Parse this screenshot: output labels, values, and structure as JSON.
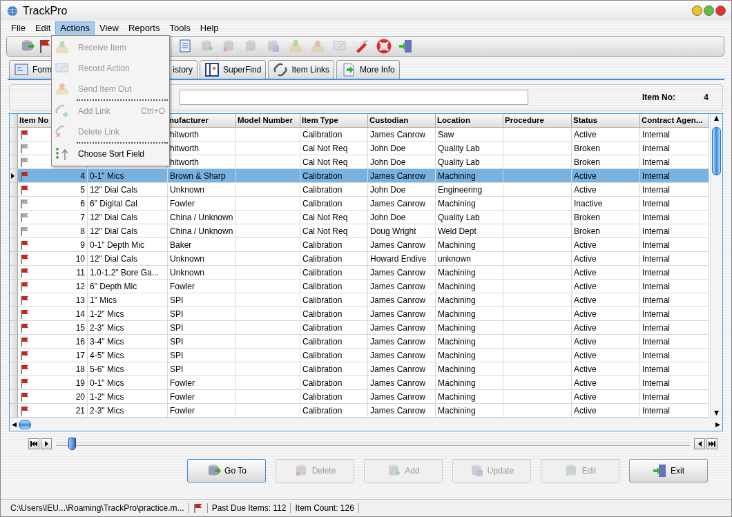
{
  "window": {
    "title": "TrackPro"
  },
  "menu_bar": [
    {
      "label": "File",
      "selected": false
    },
    {
      "label": "Edit",
      "selected": false
    },
    {
      "label": "Actions",
      "selected": true
    },
    {
      "label": "View",
      "selected": false
    },
    {
      "label": "Reports",
      "selected": false
    },
    {
      "label": "Tools",
      "selected": false
    },
    {
      "label": "Help",
      "selected": false
    }
  ],
  "actions_menu": [
    {
      "kind": "item",
      "label": "Receive Item",
      "disabled": true
    },
    {
      "kind": "item",
      "label": "Record Action",
      "disabled": true
    },
    {
      "kind": "item",
      "label": "Send Item Out",
      "disabled": true
    },
    {
      "kind": "separator"
    },
    {
      "kind": "item",
      "label": "Add Link",
      "shortcut": "Ctrl+O",
      "disabled": true
    },
    {
      "kind": "item",
      "label": "Delete Link",
      "disabled": true
    },
    {
      "kind": "separator"
    },
    {
      "kind": "item",
      "label": "Choose Sort Field",
      "disabled": false
    }
  ],
  "tabs": [
    {
      "label": "Form",
      "selected": false
    },
    {
      "label": "istory",
      "selected": false
    },
    {
      "label": "SuperFind",
      "selected": false
    },
    {
      "label": "Item Links",
      "selected": false
    },
    {
      "label": "More Info",
      "selected": false
    }
  ],
  "item_no": {
    "label": "Item No:",
    "value": "4"
  },
  "table": {
    "columns": [
      "Item No",
      "",
      "nufacturer",
      "Model Number",
      "Item Type",
      "Custodian",
      "Location",
      "Procedure",
      "Status",
      "Contract Agen..."
    ],
    "rows": [
      {
        "selected": false,
        "flagged": true,
        "cells": [
          "",
          "",
          "hitworth",
          "",
          "Calibration",
          "James Canrow",
          "Saw",
          "",
          "Active",
          "Internal"
        ]
      },
      {
        "selected": false,
        "flagged": false,
        "cells": [
          "",
          "",
          "hitworth",
          "",
          "Cal Not Req",
          "John Doe",
          "Quality Lab",
          "",
          "Broken",
          "Internal"
        ]
      },
      {
        "selected": false,
        "flagged": false,
        "cells": [
          "",
          "",
          "hitworth",
          "",
          "Cal Not Req",
          "John Doe",
          "Quality Lab",
          "",
          "Broken",
          "Internal"
        ]
      },
      {
        "selected": true,
        "flagged": true,
        "cells": [
          "4",
          "0-1\" Mics",
          "Brown & Sharp",
          "",
          "Calibration",
          "James Canrow",
          "Machining",
          "",
          "Active",
          "Internal"
        ]
      },
      {
        "selected": false,
        "flagged": true,
        "cells": [
          "5",
          "12\" Dial Cals",
          "Unknown",
          "",
          "Calibration",
          "John Doe",
          "Engineering",
          "",
          "Active",
          "Internal"
        ]
      },
      {
        "selected": false,
        "flagged": false,
        "cells": [
          "6",
          "6\" Digital Cal",
          "Fowler",
          "",
          "Calibration",
          "James Canrow",
          "Machining",
          "",
          "Inactive",
          "Internal"
        ]
      },
      {
        "selected": false,
        "flagged": false,
        "cells": [
          "7",
          "12\" Dial Cals",
          "China / Unknown",
          "",
          "Cal Not Req",
          "John Doe",
          "Quality Lab",
          "",
          "Broken",
          "Internal"
        ]
      },
      {
        "selected": false,
        "flagged": false,
        "cells": [
          "8",
          "12\" Dial Cals",
          "China / Unknown",
          "",
          "Cal Not Req",
          "Doug Wright",
          "Weld Dept",
          "",
          "Broken",
          "Internal"
        ]
      },
      {
        "selected": false,
        "flagged": true,
        "cells": [
          "9",
          "0-1\" Depth Mic",
          "Baker",
          "",
          "Calibration",
          "James Canrow",
          "Machining",
          "",
          "Active",
          "Internal"
        ]
      },
      {
        "selected": false,
        "flagged": true,
        "cells": [
          "10",
          "12\" Dial Cals",
          "Unknown",
          "",
          "Calibration",
          "Howard Endive",
          "unknown",
          "",
          "Active",
          "Internal"
        ]
      },
      {
        "selected": false,
        "flagged": true,
        "cells": [
          "11",
          "1.0-1.2\" Bore Ga...",
          "Unknown",
          "",
          "Calibration",
          "James Canrow",
          "Machining",
          "",
          "Active",
          "Internal"
        ]
      },
      {
        "selected": false,
        "flagged": true,
        "cells": [
          "12",
          "6\" Depth Mic",
          "Fowler",
          "",
          "Calibration",
          "James Canrow",
          "Machining",
          "",
          "Active",
          "Internal"
        ]
      },
      {
        "selected": false,
        "flagged": true,
        "cells": [
          "13",
          "1\" Mics",
          "SPI",
          "",
          "Calibration",
          "James Canrow",
          "Machining",
          "",
          "Active",
          "Internal"
        ]
      },
      {
        "selected": false,
        "flagged": true,
        "cells": [
          "14",
          "1-2\" Mics",
          "SPI",
          "",
          "Calibration",
          "James Canrow",
          "Machining",
          "",
          "Active",
          "Internal"
        ]
      },
      {
        "selected": false,
        "flagged": true,
        "cells": [
          "15",
          "2-3\" Mics",
          "SPI",
          "",
          "Calibration",
          "James Canrow",
          "Machining",
          "",
          "Active",
          "Internal"
        ]
      },
      {
        "selected": false,
        "flagged": true,
        "cells": [
          "16",
          "3-4\" Mics",
          "SPI",
          "",
          "Calibration",
          "James Canrow",
          "Machining",
          "",
          "Active",
          "Internal"
        ]
      },
      {
        "selected": false,
        "flagged": true,
        "cells": [
          "17",
          "4-5\" Mics",
          "SPI",
          "",
          "Calibration",
          "James Canrow",
          "Machining",
          "",
          "Active",
          "Internal"
        ]
      },
      {
        "selected": false,
        "flagged": true,
        "cells": [
          "18",
          "5-6\" Mics",
          "SPI",
          "",
          "Calibration",
          "James Canrow",
          "Machining",
          "",
          "Active",
          "Internal"
        ]
      },
      {
        "selected": false,
        "flagged": true,
        "cells": [
          "19",
          "0-1\" Mics",
          "Fowler",
          "",
          "Calibration",
          "James Canrow",
          "Machining",
          "",
          "Active",
          "Internal"
        ]
      },
      {
        "selected": false,
        "flagged": true,
        "cells": [
          "20",
          "1-2\" Mics",
          "Fowler",
          "",
          "Calibration",
          "James Canrow",
          "Machining",
          "",
          "Active",
          "Internal"
        ]
      },
      {
        "selected": false,
        "flagged": true,
        "cells": [
          "21",
          "2-3\" Mics",
          "Fowler",
          "",
          "Calibration",
          "James Canrow",
          "Machining",
          "",
          "Active",
          "Internal"
        ]
      }
    ]
  },
  "navigator": {
    "level": 0.025
  },
  "buttons": [
    {
      "label": "Go To",
      "disabled": false
    },
    {
      "label": "Delete",
      "disabled": true
    },
    {
      "label": "Add",
      "disabled": true
    },
    {
      "label": "Update",
      "disabled": true
    },
    {
      "label": "Edit",
      "disabled": true
    },
    {
      "label": "Exit",
      "disabled": false
    }
  ],
  "status_bar": {
    "path": "C:\\Users\\IEU...\\Roaming\\TrackPro\\practice.m...",
    "past_due": "Past Due Items: 112",
    "item_count": "Item Count: 126"
  }
}
